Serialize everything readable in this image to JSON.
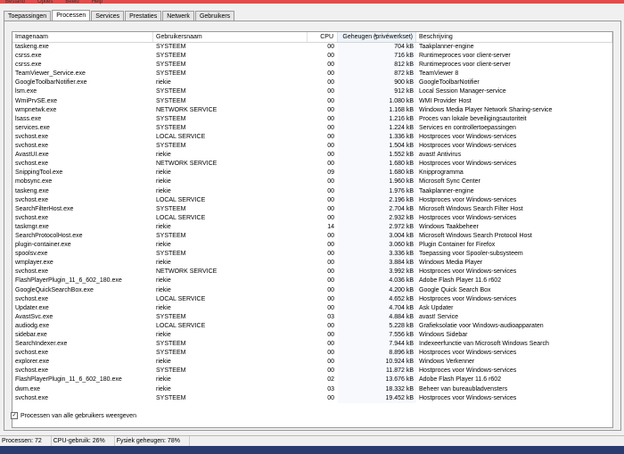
{
  "menu": [
    "Bestand",
    "Opties",
    "Beeld",
    "Help"
  ],
  "tabs": [
    {
      "label": "Toepassingen",
      "active": false
    },
    {
      "label": "Processen",
      "active": true
    },
    {
      "label": "Services",
      "active": false
    },
    {
      "label": "Prestaties",
      "active": false
    },
    {
      "label": "Netwerk",
      "active": false
    },
    {
      "label": "Gebruikers",
      "active": false
    }
  ],
  "columns": [
    "Imagenaam",
    "Gebruikersnaam",
    "CPU",
    "Geheugen (privéwerkset)",
    "Beschrijving"
  ],
  "rows": [
    [
      "taskeng.exe",
      "SYSTEEM",
      "00",
      "704 kB",
      "Taakplanner-engine"
    ],
    [
      "csrss.exe",
      "SYSTEEM",
      "00",
      "716 kB",
      "Runtimeproces voor client-server"
    ],
    [
      "csrss.exe",
      "SYSTEEM",
      "00",
      "812 kB",
      "Runtimeproces voor client-server"
    ],
    [
      "TeamViewer_Service.exe",
      "SYSTEEM",
      "00",
      "872 kB",
      "TeamViewer 8"
    ],
    [
      "GoogleToolbarNotifier.exe",
      "riekie",
      "00",
      "900 kB",
      "GoogleToolbarNotifier"
    ],
    [
      "lsm.exe",
      "SYSTEEM",
      "00",
      "912 kB",
      "Local Session Manager-service"
    ],
    [
      "WmiPrvSE.exe",
      "SYSTEEM",
      "00",
      "1.080 kB",
      "WMI Provider Host"
    ],
    [
      "wmpnetwk.exe",
      "NETWORK SERVICE",
      "00",
      "1.168 kB",
      "Windows Media Player Network Sharing-service"
    ],
    [
      "lsass.exe",
      "SYSTEEM",
      "00",
      "1.216 kB",
      "Proces van lokale beveiligingsautoriteit"
    ],
    [
      "services.exe",
      "SYSTEEM",
      "00",
      "1.224 kB",
      "Services en controllertoepassingen"
    ],
    [
      "svchost.exe",
      "LOCAL SERVICE",
      "00",
      "1.336 kB",
      "Hostproces voor Windows-services"
    ],
    [
      "svchost.exe",
      "SYSTEEM",
      "00",
      "1.504 kB",
      "Hostproces voor Windows-services"
    ],
    [
      "AvastUI.exe",
      "riekie",
      "00",
      "1.552 kB",
      "avast! Antivirus"
    ],
    [
      "svchost.exe",
      "NETWORK SERVICE",
      "00",
      "1.680 kB",
      "Hostproces voor Windows-services"
    ],
    [
      "SnippingTool.exe",
      "riekie",
      "09",
      "1.680 kB",
      "Knipprogramma"
    ],
    [
      "mobsync.exe",
      "riekie",
      "00",
      "1.960 kB",
      "Microsoft Sync Center"
    ],
    [
      "taskeng.exe",
      "riekie",
      "00",
      "1.976 kB",
      "Taakplanner-engine"
    ],
    [
      "svchost.exe",
      "LOCAL SERVICE",
      "00",
      "2.196 kB",
      "Hostproces voor Windows-services"
    ],
    [
      "SearchFilterHost.exe",
      "SYSTEEM",
      "00",
      "2.704 kB",
      "Microsoft Windows Search Filter Host"
    ],
    [
      "svchost.exe",
      "LOCAL SERVICE",
      "00",
      "2.932 kB",
      "Hostproces voor Windows-services"
    ],
    [
      "taskmgr.exe",
      "riekie",
      "14",
      "2.972 kB",
      "Windows Taakbeheer"
    ],
    [
      "SearchProtocolHost.exe",
      "SYSTEEM",
      "00",
      "3.004 kB",
      "Microsoft Windows Search Protocol Host"
    ],
    [
      "plugin-container.exe",
      "riekie",
      "00",
      "3.060 kB",
      "Plugin Container for Firefox"
    ],
    [
      "spoolsv.exe",
      "SYSTEEM",
      "00",
      "3.336 kB",
      "Toepassing voor Spooler-subsysteem"
    ],
    [
      "wmplayer.exe",
      "riekie",
      "00",
      "3.884 kB",
      "Windows Media Player"
    ],
    [
      "svchost.exe",
      "NETWORK SERVICE",
      "00",
      "3.992 kB",
      "Hostproces voor Windows-services"
    ],
    [
      "FlashPlayerPlugin_11_6_602_180.exe",
      "riekie",
      "00",
      "4.036 kB",
      "Adobe Flash Player 11.6 r602"
    ],
    [
      "GoogleQuickSearchBox.exe",
      "riekie",
      "00",
      "4.200 kB",
      "Google Quick Search Box"
    ],
    [
      "svchost.exe",
      "LOCAL SERVICE",
      "00",
      "4.652 kB",
      "Hostproces voor Windows-services"
    ],
    [
      "Updater.exe",
      "riekie",
      "00",
      "4.704 kB",
      "Ask Updater"
    ],
    [
      "AvastSvc.exe",
      "SYSTEEM",
      "03",
      "4.884 kB",
      "avast! Service"
    ],
    [
      "audiodg.exe",
      "LOCAL SERVICE",
      "00",
      "5.228 kB",
      "Grafieksolatie voor Windows-audioapparaten"
    ],
    [
      "sidebar.exe",
      "riekie",
      "00",
      "7.556 kB",
      "Windows Sidebar"
    ],
    [
      "SearchIndexer.exe",
      "SYSTEEM",
      "00",
      "7.944 kB",
      "Indexeerfunctie van Microsoft Windows Search"
    ],
    [
      "svchost.exe",
      "SYSTEEM",
      "00",
      "8.896 kB",
      "Hostproces voor Windows-services"
    ],
    [
      "explorer.exe",
      "riekie",
      "00",
      "10.924 kB",
      "Windows Verkenner"
    ],
    [
      "svchost.exe",
      "SYSTEEM",
      "00",
      "11.872 kB",
      "Hostproces voor Windows-services"
    ],
    [
      "FlashPlayerPlugin_11_6_602_180.exe",
      "riekie",
      "02",
      "13.676 kB",
      "Adobe Flash Player 11.6 r602"
    ],
    [
      "dwm.exe",
      "riekie",
      "03",
      "18.332 kB",
      "Beheer van bureaubladvensters"
    ],
    [
      "svchost.exe",
      "SYSTEEM",
      "00",
      "19.452 kB",
      "Hostproces voor Windows-services"
    ]
  ],
  "show_all_label": "Processen van alle gebruikers weergeven",
  "status": {
    "processes": "Processen: 72",
    "cpu": "CPU-gebruik: 26%",
    "memory": "Fysiek geheugen: 78%"
  }
}
